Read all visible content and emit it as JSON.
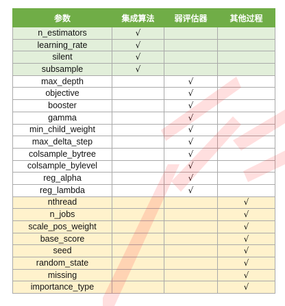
{
  "table": {
    "headers": [
      "参数",
      "集成算法",
      "弱评估器",
      "其他过程"
    ],
    "check_mark": "√",
    "rows": [
      {
        "param": "n_estimators",
        "group": "ensemble",
        "ensemble": "√",
        "weak": "",
        "other": ""
      },
      {
        "param": "learning_rate",
        "group": "ensemble",
        "ensemble": "√",
        "weak": "",
        "other": ""
      },
      {
        "param": "silent",
        "group": "ensemble",
        "ensemble": "√",
        "weak": "",
        "other": ""
      },
      {
        "param": "subsample",
        "group": "ensemble",
        "ensemble": "√",
        "weak": "",
        "other": ""
      },
      {
        "param": "max_depth",
        "group": "weak",
        "ensemble": "",
        "weak": "√",
        "other": ""
      },
      {
        "param": "objective",
        "group": "weak",
        "ensemble": "",
        "weak": "√",
        "other": ""
      },
      {
        "param": "booster",
        "group": "weak",
        "ensemble": "",
        "weak": "√",
        "other": ""
      },
      {
        "param": "gamma",
        "group": "weak",
        "ensemble": "",
        "weak": "√",
        "other": ""
      },
      {
        "param": "min_child_weight",
        "group": "weak",
        "ensemble": "",
        "weak": "√",
        "other": ""
      },
      {
        "param": "max_delta_step",
        "group": "weak",
        "ensemble": "",
        "weak": "√",
        "other": ""
      },
      {
        "param": "colsample_bytree",
        "group": "weak",
        "ensemble": "",
        "weak": "√",
        "other": ""
      },
      {
        "param": "colsample_bylevel",
        "group": "weak",
        "ensemble": "",
        "weak": "√",
        "other": ""
      },
      {
        "param": "reg_alpha",
        "group": "weak",
        "ensemble": "",
        "weak": "√",
        "other": ""
      },
      {
        "param": "reg_lambda",
        "group": "weak",
        "ensemble": "",
        "weak": "√",
        "other": ""
      },
      {
        "param": "nthread",
        "group": "other",
        "ensemble": "",
        "weak": "",
        "other": "√"
      },
      {
        "param": "n_jobs",
        "group": "other",
        "ensemble": "",
        "weak": "",
        "other": "√"
      },
      {
        "param": "scale_pos_weight",
        "group": "other",
        "ensemble": "",
        "weak": "",
        "other": "√"
      },
      {
        "param": "base_score",
        "group": "other",
        "ensemble": "",
        "weak": "",
        "other": "√"
      },
      {
        "param": "seed",
        "group": "other",
        "ensemble": "",
        "weak": "",
        "other": "√"
      },
      {
        "param": "random_state",
        "group": "other",
        "ensemble": "",
        "weak": "",
        "other": "√"
      },
      {
        "param": "missing",
        "group": "other",
        "ensemble": "",
        "weak": "",
        "other": "√"
      },
      {
        "param": "importance_type",
        "group": "other",
        "ensemble": "",
        "weak": "",
        "other": "√"
      }
    ]
  },
  "colors": {
    "header": "#70ad47",
    "ensemble_fill": "#e2efda",
    "other_fill": "#fff2cc",
    "watermark": "#ff1a1a"
  },
  "watermark": {
    "icon": "diagonal-red-watermark-strokes"
  }
}
